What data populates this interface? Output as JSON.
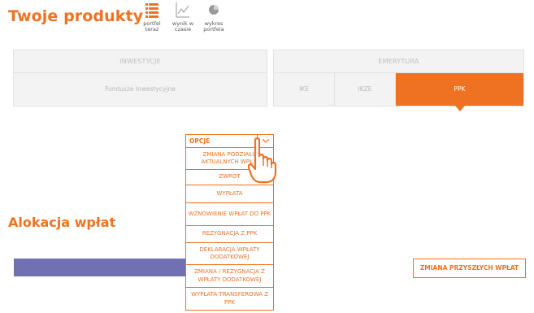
{
  "page": {
    "title": "Twoje produkty"
  },
  "view_switch": [
    {
      "label": "portfel teraz",
      "icon": "list-icon"
    },
    {
      "label": "wynik w czasie",
      "icon": "line-chart-icon"
    },
    {
      "label": "wykres portfela",
      "icon": "pie-chart-icon"
    }
  ],
  "categories": {
    "investments": {
      "title": "INWESTYCJE",
      "items": [
        "Fundusze Inwestycyjne"
      ]
    },
    "retirement": {
      "title": "EMERYTURA",
      "items": [
        "IKE",
        "IKZE",
        "PPK"
      ],
      "active": "PPK"
    }
  },
  "options_menu": {
    "label": "OPCJE",
    "items": [
      "ZMIANA PODZIAŁU AKTUALNYCH WPŁ...",
      "ZWROT",
      "WYPŁATA",
      "WZNOWIENIE WPŁAT DO PPK",
      "REZYGNACJA Z PPK",
      "DEKLARACJA WPŁATY DODATKOWEJ",
      "ZMIANA / REZYGNACJA Z WPŁATY DODATKOWEJ",
      "WYPŁATA TRANSFEROWA Z PPK"
    ]
  },
  "allocation": {
    "title": "Alokacja wpłat",
    "bar_color": "#7070b2",
    "future_button": "ZMIANA PRZYSZŁYCH WPŁAT"
  },
  "colors": {
    "accent": "#ee7222",
    "panel": "#f3f3f3"
  }
}
